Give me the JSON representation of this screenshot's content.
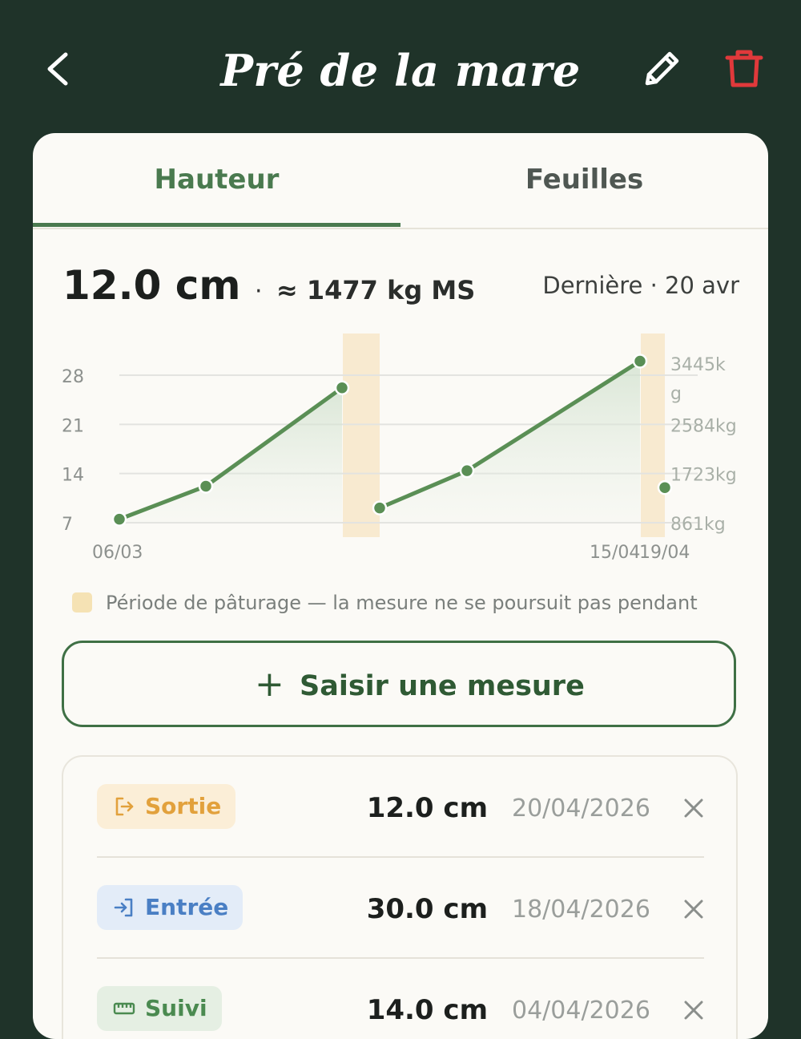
{
  "header": {
    "title": "Pré de la mare",
    "back_icon": "chevron-left-icon",
    "edit_icon": "pencil-icon",
    "delete_icon": "trash-icon",
    "delete_color": "#e0393b"
  },
  "tabs": [
    {
      "label": "Hauteur",
      "active": true
    },
    {
      "label": "Feuilles",
      "active": false
    }
  ],
  "summary": {
    "height": "12.0 cm",
    "separator": "·",
    "biomass": "≈ 1477 kg MS",
    "last_label": "Dernière · 20 avr"
  },
  "chart_data": {
    "type": "line",
    "y_ticks": [
      "28",
      "21",
      "14",
      "7"
    ],
    "y_tick_values": [
      28,
      21,
      14,
      7
    ],
    "right_axis_labels": [
      "3445kg",
      "2584kg",
      "1723kg",
      "861kg"
    ],
    "x_tick_labels": [
      "06/03",
      "15/04",
      "19/04"
    ],
    "ylim": [
      7,
      28
    ],
    "series": [
      {
        "values": [
          {
            "x": "06/03",
            "y": 7.5
          },
          {
            "x": "",
            "y": 12.2
          },
          {
            "x": "",
            "y": 26.2
          },
          {
            "x": "",
            "y": 9.1
          },
          {
            "x": "",
            "y": 14.4
          },
          {
            "x": "15/04",
            "y": 30.0
          },
          {
            "x": "19/04",
            "y": 12.0
          }
        ]
      }
    ],
    "grazing_periods": [
      {
        "start_index": 2,
        "end_index": 3
      },
      {
        "start_index": 5,
        "end_index": 6
      }
    ],
    "colors": {
      "line": "#5a8f55",
      "grazing": "#f8ead0",
      "grid": "#e3e3e0"
    }
  },
  "legend": {
    "text": "Période de pâturage — la mesure ne se poursuit pas pendant",
    "color": "#f5e2b4"
  },
  "add_button": {
    "icon": "plus-icon",
    "label": "Saisir une mesure"
  },
  "measures": [
    {
      "type": "Sortie",
      "icon": "exit-icon",
      "value": "12.0 cm",
      "date": "20/04/2026"
    },
    {
      "type": "Entrée",
      "icon": "enter-icon",
      "value": "30.0 cm",
      "date": "18/04/2026"
    },
    {
      "type": "Suivi",
      "icon": "ruler-icon",
      "value": "14.0 cm",
      "date": "04/04/2026"
    }
  ]
}
